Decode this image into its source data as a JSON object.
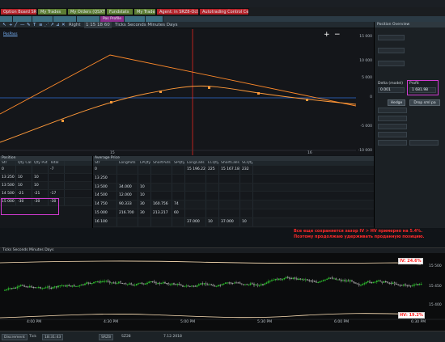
{
  "window": {
    "title": ""
  },
  "tabs": [
    {
      "label": "Option Board SRZ8",
      "color": "#b7242b"
    },
    {
      "label": "My Trades",
      "color": "#5d7d34"
    },
    {
      "label": "My Orders (QSXT)",
      "color": "#5d7d34"
    },
    {
      "label": "Fundstats",
      "color": "#5d7d34"
    },
    {
      "label": "My Trades",
      "color": "#5d7d34"
    },
    {
      "label": "Agent: in SRZ8-Oct",
      "color": "#b7242b"
    },
    {
      "label": "Autotrading Control Center",
      "color": "#b7242b"
    }
  ],
  "subtabs": [
    "",
    "",
    "",
    "",
    "",
    "Pos Profile",
    "",
    ""
  ],
  "toolbar": {
    "mode": "Right",
    "tick_input": "1 15 18 60",
    "units_label": "Ticks  Seconds  Minutes  Days"
  },
  "chart": {
    "legend": "PosPass",
    "zoom_in": "+",
    "zoom_out": "−",
    "y_ticks": [
      "15 000",
      "10 000",
      "5 000",
      "0",
      "-5 000",
      "-10 000"
    ],
    "x_ticks": [
      "15",
      "16"
    ],
    "colors": {
      "expiry": "#ff8a2a",
      "today": "#ff9a3a",
      "zero": "#2f6fd6",
      "spot": "#e0271f"
    }
  },
  "position_grid": {
    "title": "Position",
    "columns": [
      "Str",
      "Qty Call",
      "Qty Put",
      "Total"
    ],
    "rows": [
      [
        "0",
        "",
        "",
        "-7"
      ],
      [
        "13 250",
        "10",
        "10",
        ""
      ],
      [
        "13 500",
        "10",
        "10",
        ""
      ],
      [
        "14 500",
        "-21",
        "-21",
        "-17"
      ],
      [
        "15 000",
        "-30",
        "-30",
        "-30"
      ]
    ]
  },
  "avg_grid": {
    "title": "Average Price",
    "columns": [
      "Str",
      "LongPuts",
      "LPQty",
      "ShortPuts",
      "SPQty",
      "LongCalls",
      "LCQty",
      "ShortCalls",
      "SCQty"
    ],
    "rows": [
      [
        "0",
        "",
        "",
        "",
        "",
        "15 196.227",
        "225",
        "15 167.186",
        "232"
      ],
      [
        "13 250",
        "",
        "",
        "",
        "",
        "",
        "",
        "",
        ""
      ],
      [
        "13 500",
        "34.000",
        "10",
        "",
        "",
        "",
        "",
        "",
        ""
      ],
      [
        "14 500",
        "12.000",
        "10",
        "",
        "",
        "",
        "",
        "",
        ""
      ],
      [
        "14 750",
        "90.333",
        "30",
        "160.756",
        "74",
        "",
        "",
        "",
        ""
      ],
      [
        "15 000",
        "216.700",
        "30",
        "213.217",
        "60",
        "",
        "",
        "",
        ""
      ],
      [
        "16 100",
        "",
        "",
        "",
        "",
        "37.000",
        "10",
        "37.000",
        "10"
      ]
    ]
  },
  "overview": {
    "title": "Position Overview",
    "fields": [
      {
        "label": "",
        "value": ""
      },
      {
        "label": "",
        "value": ""
      },
      {
        "label": "",
        "value": ""
      }
    ],
    "delta_label": "Delta (model)",
    "delta_value": "0.001",
    "profit_label": "Profit",
    "profit_value": "1 681.98",
    "hedge_button": "Hedge",
    "drop_button": "Drop sml pa"
  },
  "annotation": [
    "Все еще сохраняется зазор IV > HV примерно на 5.4%.",
    "Поэтому продолжаю удерживать проданную позицию."
  ],
  "bottom_chart": {
    "header": "Ticks  Seconds  Minutes  Days",
    "iv_label": "IV: 24.6%",
    "hv_label": "HV: 19.2%",
    "y_ticks": [
      "15 500",
      "15 450",
      "15 400"
    ],
    "x_ticks": [
      "4:00 PM",
      "4:30 PM",
      "5:00 PM",
      "5:30 PM",
      "6:00 PM",
      "6:30 PM"
    ]
  },
  "statusbar": {
    "discrement": "Discrement",
    "tick": "Tick",
    "time": "18:31:43",
    "symbol": "SRZ8",
    "field": "SZ28",
    "date": "7.12.2018"
  }
}
